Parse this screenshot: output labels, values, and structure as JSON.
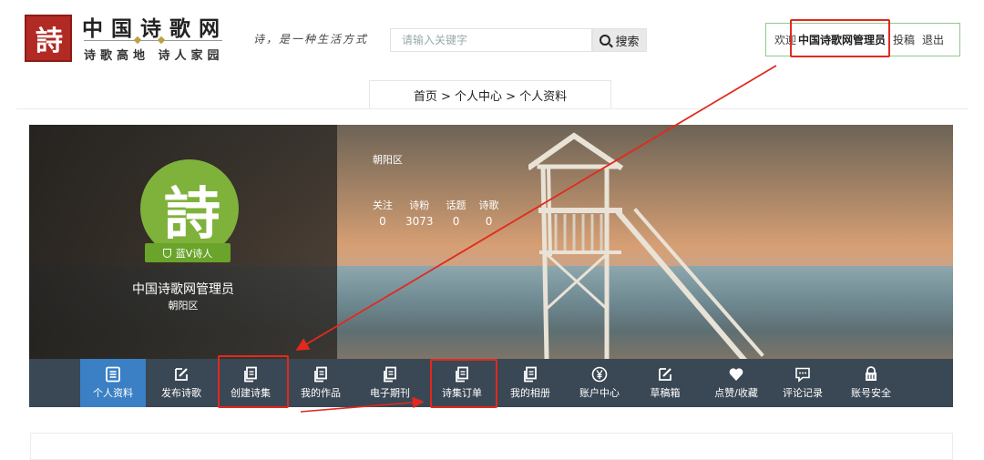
{
  "header": {
    "logo_glyph": "詩",
    "site_name": "中国诗歌网",
    "tagline": "诗歌高地 诗人家园",
    "slogan": "诗，是一种生活方式",
    "search": {
      "placeholder": "请输入关键字",
      "button_label": "搜索"
    },
    "user": {
      "welcome": "欢迎",
      "username": "中国诗歌网管理员",
      "submit_label": "投稿",
      "logout_label": "退出"
    }
  },
  "breadcrumb": "首页 > 个人中心 > 个人资料",
  "profile": {
    "avatar_glyph": "詩",
    "badge": "蓝V诗人",
    "name": "中国诗歌网管理员",
    "district": "朝阳区",
    "location": "朝阳区",
    "stats": [
      {
        "label": "关注",
        "value": "0"
      },
      {
        "label": "诗粉",
        "value": "3073"
      },
      {
        "label": "话题",
        "value": "0"
      },
      {
        "label": "诗歌",
        "value": "0"
      }
    ]
  },
  "nav": {
    "items": [
      {
        "label": "个人资料",
        "icon": "list-icon",
        "active": true
      },
      {
        "label": "发布诗歌",
        "icon": "edit-icon"
      },
      {
        "label": "创建诗集",
        "icon": "copy-icon"
      },
      {
        "label": "我的作品",
        "icon": "copy-icon"
      },
      {
        "label": "电子期刊",
        "icon": "copy-icon"
      },
      {
        "label": "诗集订单",
        "icon": "copy-icon"
      },
      {
        "label": "我的相册",
        "icon": "copy-icon"
      },
      {
        "label": "账户中心",
        "icon": "yen-icon"
      },
      {
        "label": "草稿箱",
        "icon": "edit-icon"
      },
      {
        "label": "点赞/收藏",
        "icon": "heart-icon"
      },
      {
        "label": "评论记录",
        "icon": "comment-icon"
      },
      {
        "label": "账号安全",
        "icon": "lock-icon"
      }
    ]
  },
  "colors": {
    "accent": "#3b7fc4",
    "nav_bg": "#3a4754",
    "highlight": "#e2291d",
    "brand_red": "#b12a24",
    "avatar_green": "#7fb23b"
  }
}
